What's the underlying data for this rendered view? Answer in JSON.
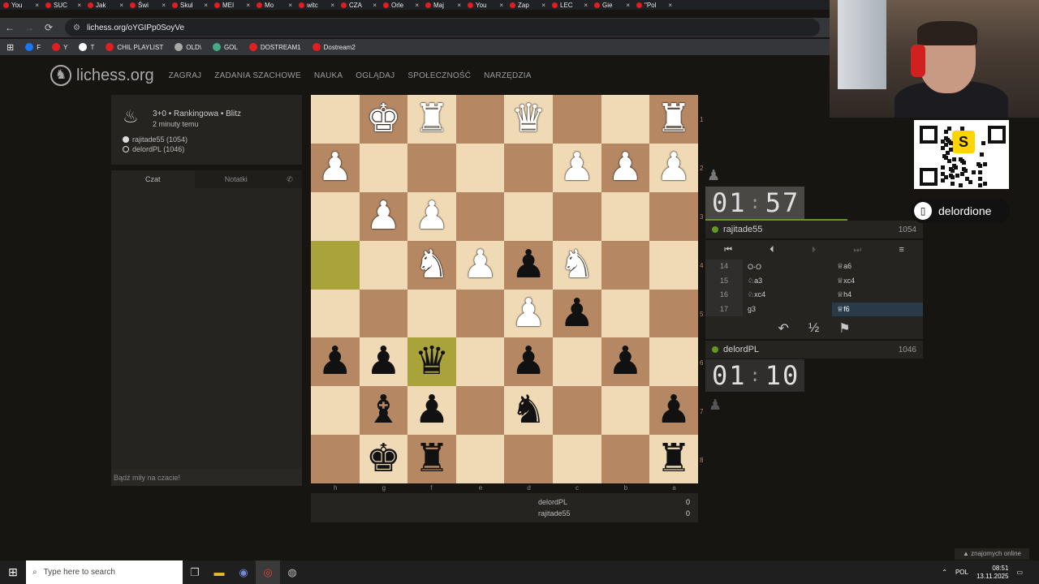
{
  "browser": {
    "tabs": [
      "You",
      "SUC",
      "Jak",
      "Świ",
      "Skul",
      "MEI",
      "Mo",
      "witc",
      "CZA",
      "Orle",
      "Maj",
      "You",
      "Zap",
      "LEC",
      "Gie",
      "\"Pol"
    ],
    "url": "lichess.org/oYGIPp0SoyVe",
    "bookmarks": [
      "F",
      "Y",
      "T",
      "CHIL PLAYLIST",
      "OLD\\",
      "GOL",
      "DOSTREAM1",
      "Dostream2"
    ]
  },
  "site": {
    "logo": "lichess.org",
    "nav": [
      "ZAGRAJ",
      "ZADANIA SZACHOWE",
      "NAUKA",
      "OGLĄDAJ",
      "SPOŁECZNOŚĆ",
      "NARZĘDZIA"
    ]
  },
  "game_info": {
    "mode": "3+0 • Rankingowa • Blitz",
    "time_ago": "2 minuty temu",
    "white_player": "rajitade55 (1054)",
    "black_player": "delordPL (1046)"
  },
  "chat": {
    "tab_chat": "Czat",
    "tab_notes": "Notatki",
    "placeholder": "Bądź miły na czacie!"
  },
  "board": {
    "ranks": [
      "1",
      "2",
      "3",
      "4",
      "5",
      "6",
      "7",
      "8"
    ],
    "files": [
      "h",
      "g",
      "f",
      "e",
      "d",
      "c",
      "b",
      "a"
    ],
    "rows": [
      [
        "",
        "wK",
        "wR",
        "",
        "wQ",
        "",
        "",
        "wR"
      ],
      [
        "wP",
        "",
        "",
        "",
        "",
        "wP",
        "wP",
        "wP"
      ],
      [
        "",
        "wP",
        "wP",
        "",
        "",
        "",
        "",
        ""
      ],
      [
        "",
        "",
        "wN",
        "wP",
        "bP",
        "wN",
        "",
        ""
      ],
      [
        "",
        "",
        "",
        "",
        "wP",
        "bP",
        "",
        ""
      ],
      [
        "bP",
        "bP",
        "bQ",
        "",
        "bP",
        "",
        "bP",
        ""
      ],
      [
        "",
        "bB",
        "bP",
        "",
        "bN",
        "",
        "",
        "bP"
      ],
      [
        "",
        "bK",
        "bR",
        "",
        "",
        "",
        "",
        "bR"
      ]
    ],
    "highlighted": [
      "3-0",
      "5-2"
    ]
  },
  "score": {
    "rows": [
      {
        "name": "delordPL",
        "points": "0"
      },
      {
        "name": "rajitade55",
        "points": "0"
      }
    ]
  },
  "top_player": {
    "clock_min": "01",
    "clock_sec": "57",
    "name": "rajitade55",
    "rating": "1054"
  },
  "bottom_player": {
    "clock_min": "01",
    "clock_sec": "10",
    "name": "delordPL",
    "rating": "1046"
  },
  "moves": [
    {
      "n": "14",
      "w": "O-O",
      "b": "♕a6"
    },
    {
      "n": "15",
      "w": "♘a3",
      "b": "♕xc4"
    },
    {
      "n": "16",
      "w": "♘xc4",
      "b": "♕h4"
    },
    {
      "n": "17",
      "w": "g3",
      "b": "♕f6"
    }
  ],
  "streamer": {
    "name": "delordione"
  },
  "friends": "znajomych online",
  "taskbar": {
    "search_placeholder": "Type here to search",
    "lang": "POL",
    "time": "08:51",
    "date": "13.11.2025"
  }
}
